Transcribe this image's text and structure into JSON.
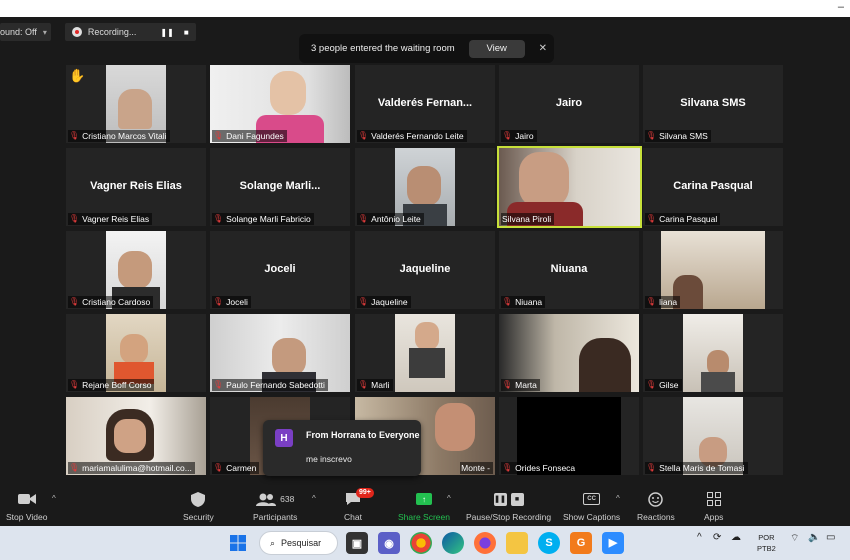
{
  "top_bar": {
    "sound_label": "ound: Off",
    "recording_label": "Recording..."
  },
  "waiting_room": {
    "message": "3 people entered the waiting room",
    "view_label": "View",
    "close_glyph": "✕"
  },
  "participants": [
    {
      "name": "Cristiano Marcos Vitali",
      "video": true,
      "hand_raised": true
    },
    {
      "name": "Dani Fagundes",
      "video": true
    },
    {
      "name": "Valderés Fernando Leite",
      "display": "Valderés  Fernan...",
      "video": false
    },
    {
      "name": "Jairo",
      "display": "Jairo",
      "video": false
    },
    {
      "name": "Silvana SMS",
      "display": "Silvana SMS",
      "video": false
    },
    {
      "name": "Vagner Reis Elias",
      "display": "Vagner Reis Elias",
      "video": false
    },
    {
      "name": "Solange  Marli  Fabricio",
      "display": "Solange   Marli...",
      "video": false
    },
    {
      "name": "Antônio Leite",
      "video": true
    },
    {
      "name": "Silvana Piroli",
      "video": true,
      "active_speaker": true
    },
    {
      "name": "Carina Pasqual",
      "display": "Carina Pasqual",
      "video": false
    },
    {
      "name": "Cristiano Cardoso",
      "video": true
    },
    {
      "name": "Joceli",
      "display": "Joceli",
      "video": false
    },
    {
      "name": "Jaqueline",
      "display": "Jaqueline",
      "video": false
    },
    {
      "name": "Niuana",
      "display": "Niuana",
      "video": false
    },
    {
      "name": "liana",
      "video": true
    },
    {
      "name": "Rejane Boff Corso",
      "video": true
    },
    {
      "name": "Paulo Fernando Sabedotti",
      "video": true
    },
    {
      "name": "Marli",
      "video": true
    },
    {
      "name": "Marta",
      "video": true
    },
    {
      "name": "Gilse",
      "video": true
    },
    {
      "name": "mariamalulima@hotmail.co...",
      "video": true
    },
    {
      "name": "Carmen",
      "video": true
    },
    {
      "name": "Monte -",
      "video": true
    },
    {
      "name": "Orides Fonseca",
      "video": true
    },
    {
      "name": "Stella Maris de Tomasi",
      "video": true
    }
  ],
  "chat_toast": {
    "avatar_letter": "H",
    "from": "From Horrana to Everyone",
    "message": "me inscrevo"
  },
  "toolbar": {
    "stop_video": "Stop Video",
    "security": "Security",
    "participants": "Participants",
    "participants_count": "638",
    "chat": "Chat",
    "chat_badge": "99+",
    "share_screen": "Share Screen",
    "pause_stop_recording": "Pause/Stop Recording",
    "show_captions": "Show Captions",
    "cc_glyph": "CC",
    "reactions": "Reactions",
    "apps": "Apps"
  },
  "taskbar": {
    "search_label": "Pesquisar",
    "lang_line1": "POR",
    "lang_line2": "PTB2"
  },
  "colors": {
    "active_speaker_border": "#c7e03a",
    "muted_mic": "#e23b3b",
    "share_green": "#23c050",
    "chat_badge": "#e0261b"
  }
}
